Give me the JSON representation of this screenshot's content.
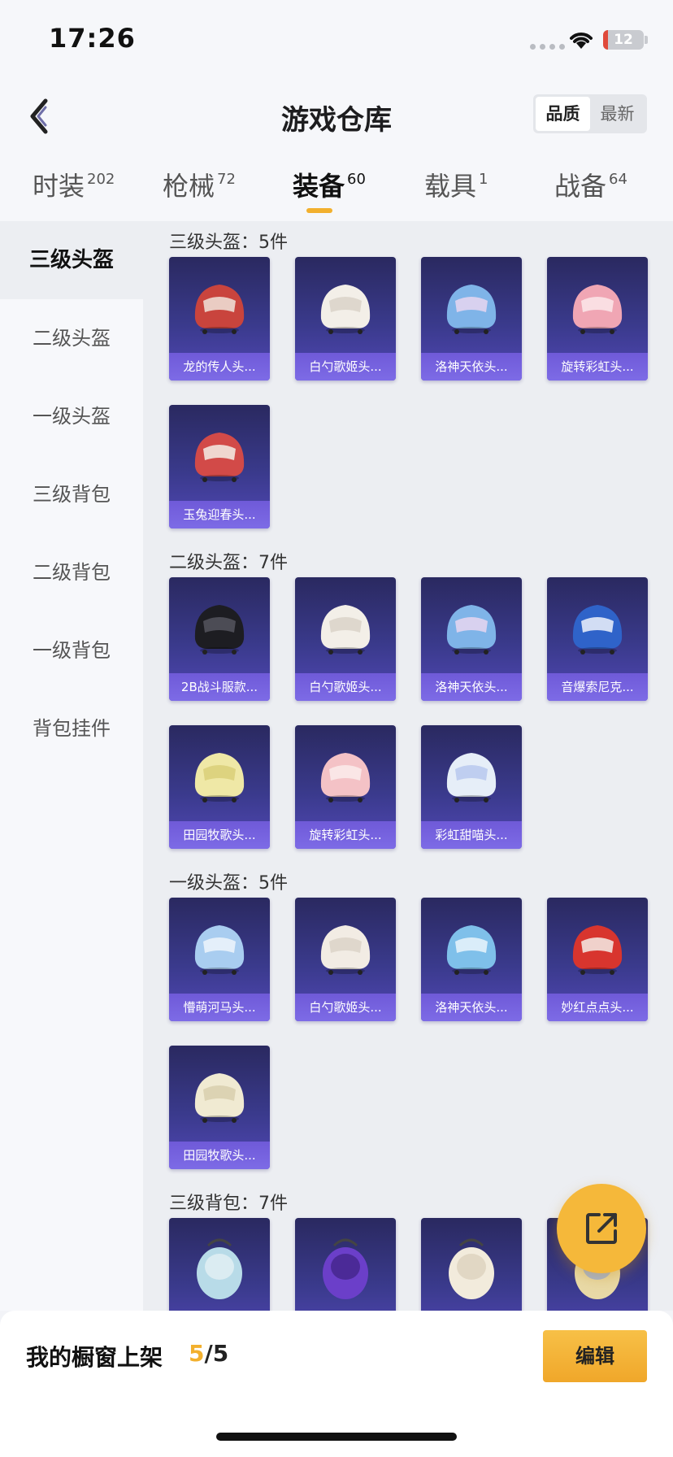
{
  "status": {
    "time": "17:26",
    "battery": "12",
    "battery_level": 0.12
  },
  "header": {
    "title": "游戏仓库",
    "sort": [
      "品质",
      "最新"
    ],
    "active_sort": 0
  },
  "tabs": [
    {
      "label": "时装",
      "count": "202"
    },
    {
      "label": "枪械",
      "count": "72"
    },
    {
      "label": "装备",
      "count": "60",
      "active": true
    },
    {
      "label": "载具",
      "count": "1"
    },
    {
      "label": "战备",
      "count": "64"
    }
  ],
  "sidebar": {
    "items": [
      "三级头盔",
      "二级头盔",
      "一级头盔",
      "三级背包",
      "二级背包",
      "一级背包",
      "背包挂件"
    ],
    "active": 0
  },
  "sections": [
    {
      "title": "三级头盔：5件",
      "items": [
        "龙的传人头...",
        "白勺歌姬头...",
        "洛神天依头...",
        "旋转彩虹头...",
        "玉兔迎春头..."
      ],
      "icons": [
        "red-tactical-helmet-icon",
        "white-bunny-helmet-icon",
        "blue-ribbon-helmet-icon",
        "pink-tactical-helmet-icon",
        "red-white-helmet-icon"
      ]
    },
    {
      "title": "二级头盔：7件",
      "items": [
        "2B战斗服款...",
        "白勺歌姬头...",
        "洛神天依头...",
        "音爆索尼克...",
        "田园牧歌头...",
        "旋转彩虹头...",
        "彩虹甜喵头..."
      ],
      "icons": [
        "black-helmet-icon",
        "white-bunny-helmet-icon",
        "blue-ribbon-helmet-icon",
        "blue-hedgehog-helmet-icon",
        "yellow-straw-helmet-icon",
        "pink-helmet-icon",
        "cat-ear-helmet-icon"
      ]
    },
    {
      "title": "一级头盔：5件",
      "items": [
        "懵萌河马头...",
        "白勺歌姬头...",
        "洛神天依头...",
        "妙红点点头...",
        "田园牧歌头..."
      ],
      "icons": [
        "blue-round-helmet-icon",
        "white-round-helmet-icon",
        "blue-stripe-helmet-icon",
        "red-round-helmet-icon",
        "cream-round-helmet-icon"
      ]
    },
    {
      "title": "三级背包：7件",
      "items": [
        "",
        "",
        "",
        ""
      ],
      "icons": [
        "hippo-backpack-icon",
        "turtle-backpack-icon",
        "cream-backpack-icon",
        "figure-backpack-icon"
      ]
    }
  ],
  "showcase": {
    "label": "我的橱窗上架",
    "current": "5",
    "total": "/5"
  },
  "actions": {
    "edit": "编辑"
  },
  "colors": {
    "accent": "#f2b02e",
    "card_bg": "#3a3a8c",
    "card_label": "#7362dd"
  }
}
